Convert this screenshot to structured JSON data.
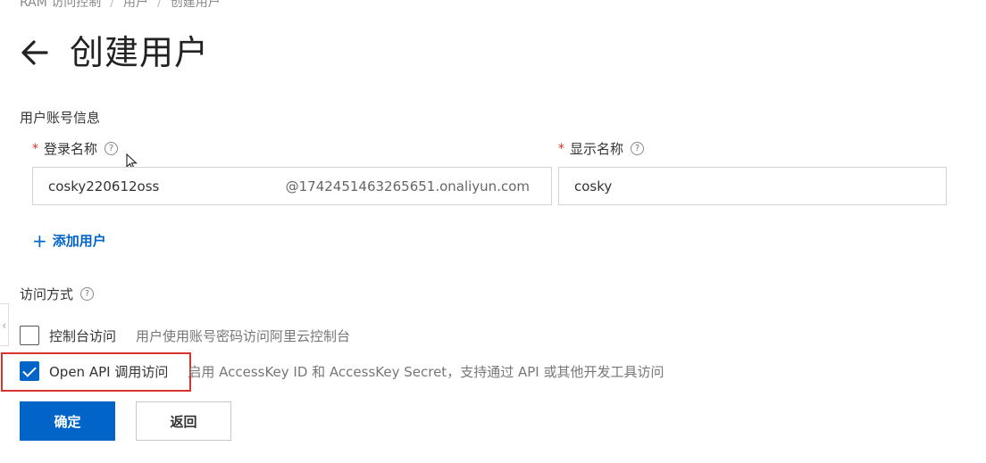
{
  "breadcrumb": {
    "items": [
      "RAM 访问控制",
      "用户",
      "创建用户"
    ]
  },
  "header": {
    "title": "创建用户"
  },
  "account_section": {
    "title": "用户账号信息",
    "login_name": {
      "required_mark": "*",
      "label": "登录名称",
      "value": "cosky220612oss",
      "suffix": "@1742451463265651.onaliyun.com"
    },
    "display_name": {
      "required_mark": "*",
      "label": "显示名称",
      "value": "cosky"
    },
    "add_user": {
      "icon": "+",
      "label": "添加用户"
    }
  },
  "access_section": {
    "title": "访问方式",
    "options": [
      {
        "label": "控制台访问",
        "description": "用户使用账号密码访问阿里云控制台",
        "checked": false
      },
      {
        "label": "Open API 调用访问",
        "description": "启用 AccessKey ID 和 AccessKey Secret，支持通过 API 或其他开发工具访问",
        "checked": true
      }
    ]
  },
  "actions": {
    "confirm_label": "确定",
    "back_label": "返回"
  },
  "colors": {
    "primary": "#0064c8",
    "required": "#d93026",
    "highlight": "#d9342b"
  },
  "icons": {
    "back": "arrow-left-icon",
    "help": "question-circle-icon",
    "collapse": "chevron-left-icon"
  }
}
